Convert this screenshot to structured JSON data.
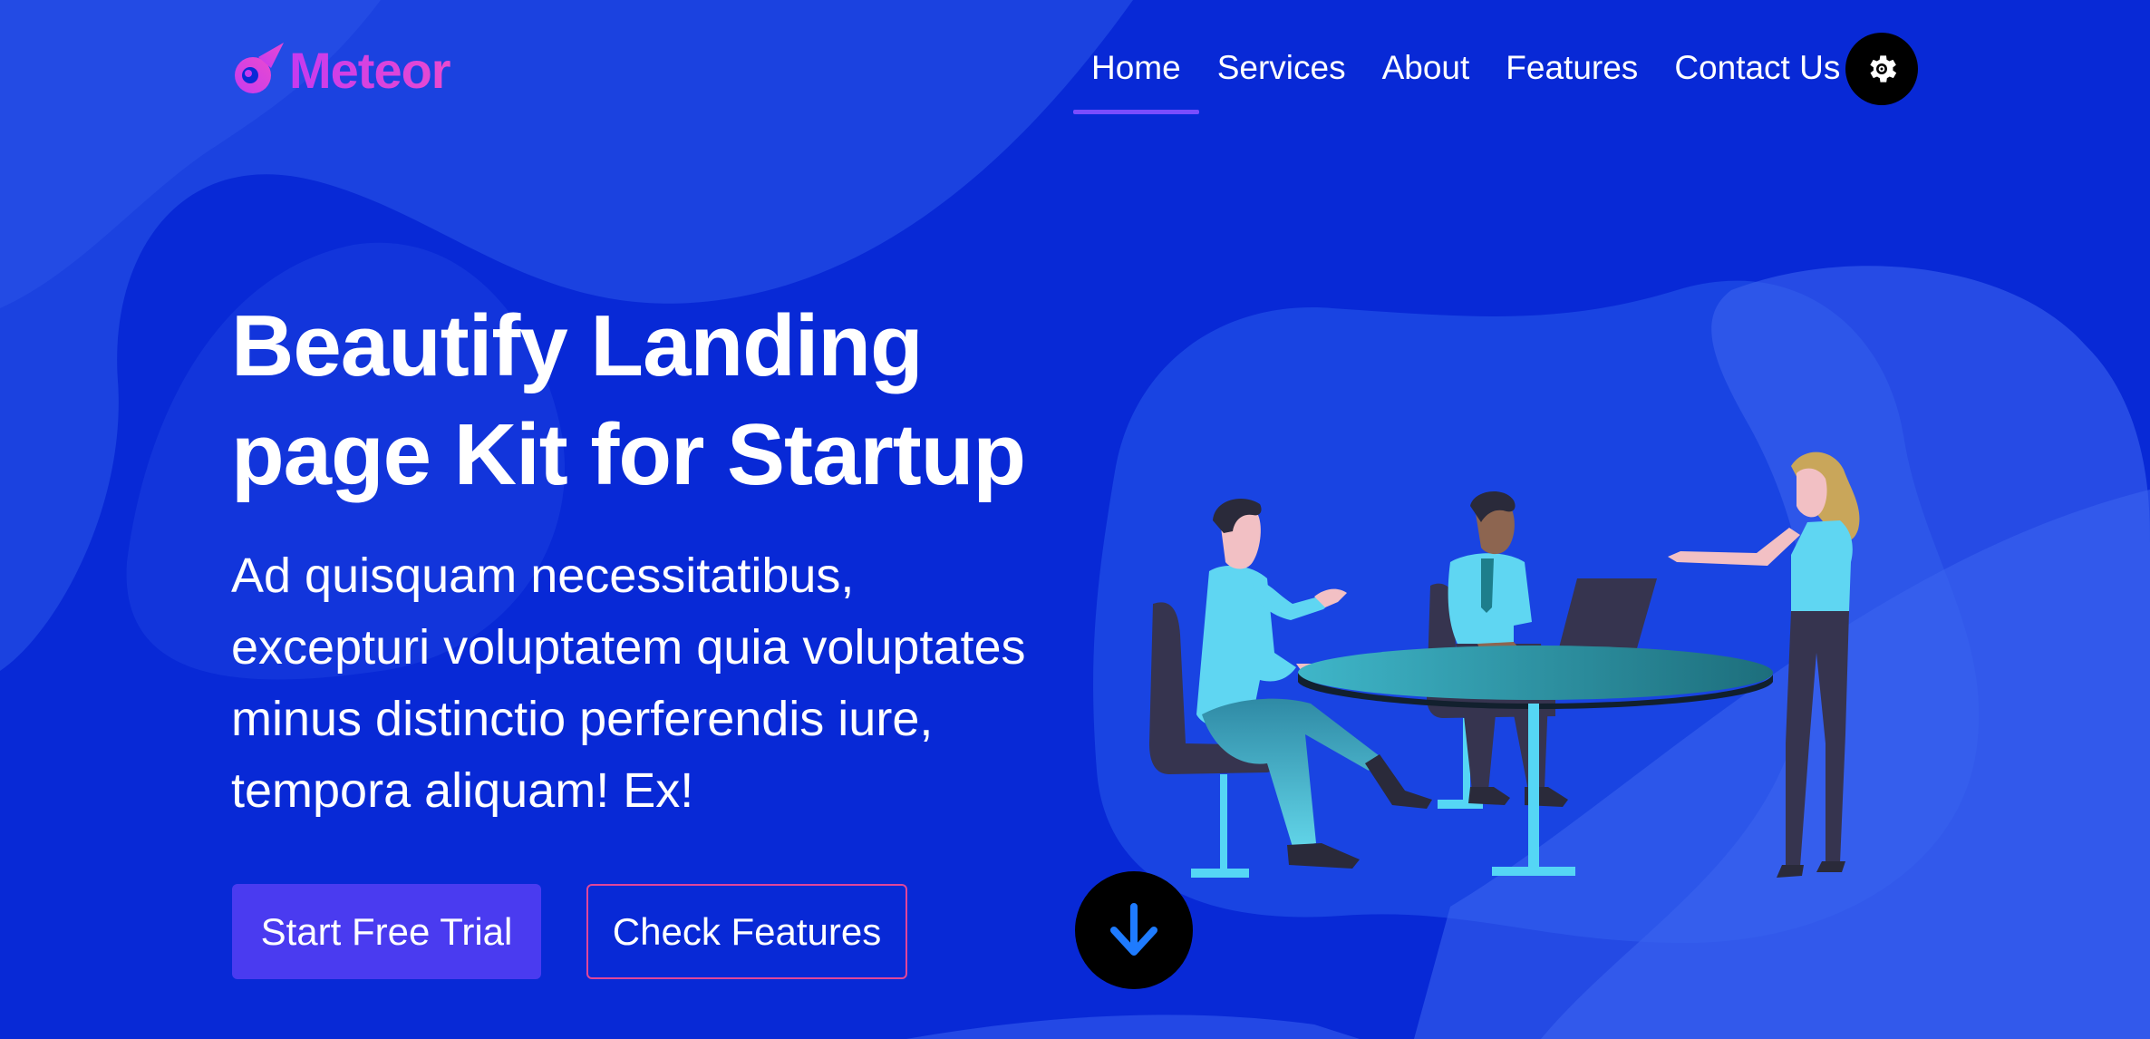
{
  "brand": {
    "name": "Meteor",
    "logo_icon": "meteor-icon"
  },
  "nav": {
    "items": [
      {
        "label": "Home",
        "active": true
      },
      {
        "label": "Services",
        "active": false
      },
      {
        "label": "About",
        "active": false
      },
      {
        "label": "Features",
        "active": false
      },
      {
        "label": "Contact Us",
        "active": false
      }
    ],
    "settings_icon": "gear-icon"
  },
  "hero": {
    "title_lines": [
      "Beautify Landing",
      "page Kit for Startup"
    ],
    "subtitle_lines": [
      "Ad quisquam necessitatibus,",
      "excepturi voluptatem quia voluptates",
      "minus distinctio perferendis iure,",
      "tempora aliquam! Ex!"
    ],
    "primary_button": "Start Free Trial",
    "secondary_button": "Check Features",
    "scroll_icon": "arrow-down-icon"
  },
  "colors": {
    "background": "#0829d6",
    "blob_light": "#2f55e8",
    "primary_button": "#4a3bf0",
    "outline_border": "#e0469a",
    "nav_underline": "#7a4dff",
    "brand_gradient_start": "#c63aef",
    "brand_gradient_end": "#e84ad0",
    "arrow": "#1e7bff"
  }
}
